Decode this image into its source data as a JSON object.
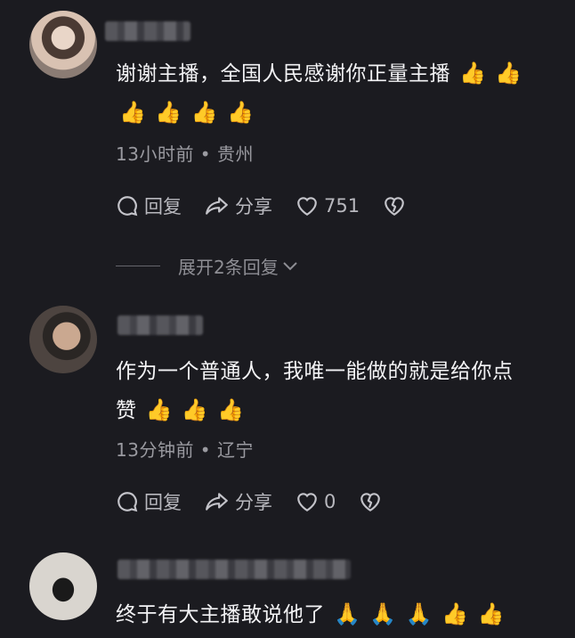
{
  "comments": [
    {
      "text": "谢谢主播，全国人民感谢你正量主播",
      "emojis_line1": [
        "👍",
        "👍"
      ],
      "emojis_line2": [
        "👍",
        "👍",
        "👍",
        "👍"
      ],
      "meta": "13小时前 • 贵州",
      "reply_label": "回复",
      "share_label": "分享",
      "likes": "751"
    },
    {
      "text": "作为一个普通人，我唯一能做的就是给你点赞",
      "text_line1": "作为一个普通人，我唯一能做的就是给你点",
      "text_line2": "赞",
      "emojis": [
        "👍",
        "👍",
        "👍"
      ],
      "meta": "13分钟前 • 辽宁",
      "reply_label": "回复",
      "share_label": "分享",
      "likes": "0"
    },
    {
      "text": "终于有大主播敢说他了",
      "emojis": [
        "🙏",
        "🙏",
        "🙏",
        "👍",
        "👍"
      ]
    }
  ],
  "expand_replies": "展开2条回复",
  "colors": {
    "background": "#1b1b20",
    "text": "#f3f3f5",
    "muted": "#9a9aa0",
    "thumb": "#f5b62a"
  }
}
